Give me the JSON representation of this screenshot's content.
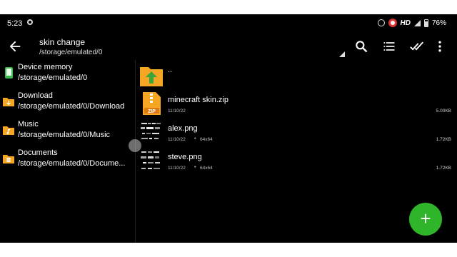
{
  "status_bar": {
    "time": "5:23",
    "network": "HD",
    "battery": "76%"
  },
  "toolbar": {
    "title": "skin change",
    "path": "/storage/emulated/0",
    "icons": [
      "back-arrow-icon",
      "search-icon",
      "list-view-icon",
      "select-all-icon",
      "more-icon"
    ]
  },
  "sidebar": {
    "items": [
      {
        "label": "Device memory",
        "path": "/storage/emulated/0",
        "icon": "phone-icon"
      },
      {
        "label": "Download",
        "path": "/storage/emulated/0/Download",
        "icon": "download-folder-icon"
      },
      {
        "label": "Music",
        "path": "/storage/emulated/0/Music",
        "icon": "music-folder-icon"
      },
      {
        "label": "Documents",
        "path": "/storage/emulated/0/Docume...",
        "icon": "documents-folder-icon"
      }
    ]
  },
  "files": {
    "parent": {
      "label": ".."
    },
    "items": [
      {
        "name": "minecraft skin.zip",
        "date": "11/10/22",
        "dims": "",
        "size": "5.00KB",
        "thumb": "zip-icon",
        "thumb_label": "ZIP"
      },
      {
        "name": "alex.png",
        "date": "11/10/22",
        "dims": "64x64",
        "size": "1.72KB",
        "thumb": "image-thumbnail"
      },
      {
        "name": "steve.png",
        "date": "11/10/22",
        "dims": "64x64",
        "size": "1.72KB",
        "thumb": "image-thumbnail"
      }
    ]
  },
  "fab": {
    "symbol": "+",
    "color": "#2fb52a"
  },
  "colors": {
    "folder": "#f5a623",
    "up_arrow": "#3aa63a",
    "device": "#3dba4e",
    "fab": "#2fb52a"
  }
}
